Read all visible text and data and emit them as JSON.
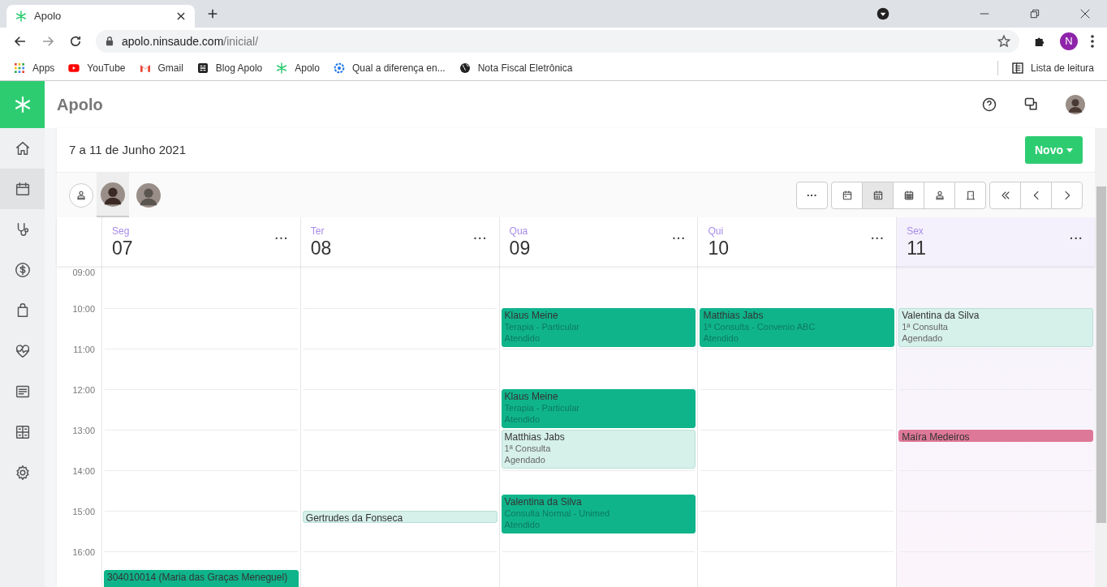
{
  "browser": {
    "tab": {
      "title": "Apolo"
    },
    "address": {
      "host": "apolo.ninsaude.com",
      "path": "/inicial/"
    },
    "profile_initial": "N",
    "bookmarks": [
      {
        "label": "Apps"
      },
      {
        "label": "YouTube"
      },
      {
        "label": "Gmail"
      },
      {
        "label": "Blog Apolo"
      },
      {
        "label": "Apolo"
      },
      {
        "label": "Qual a diferença en..."
      },
      {
        "label": "Nota Fiscal Eletrônica"
      }
    ],
    "reading_list": "Lista de leitura"
  },
  "app": {
    "name": "Apolo"
  },
  "sidebar": {
    "items": [
      {
        "selected": false
      },
      {
        "selected": true
      },
      {
        "selected": false
      },
      {
        "selected": false
      },
      {
        "selected": false
      },
      {
        "selected": false
      },
      {
        "selected": false
      },
      {
        "selected": false
      },
      {
        "selected": false
      }
    ]
  },
  "page": {
    "title": "7 a 11 de Junho 2021",
    "new_button": "Novo"
  },
  "professionals": [
    {
      "selected": true
    },
    {
      "selected": false
    }
  ],
  "toolbar": {
    "more": "···",
    "views": [
      {
        "selected": false
      },
      {
        "selected": true
      },
      {
        "selected": false
      },
      {
        "selected": false
      },
      {
        "selected": false
      }
    ]
  },
  "calendar": {
    "hours": [
      "09:00",
      "10:00",
      "11:00",
      "12:00",
      "13:00",
      "14:00",
      "15:00",
      "16:00"
    ],
    "days": [
      {
        "weekday": "Seg",
        "date": "07",
        "menu": "···",
        "today": false,
        "events": [
          {
            "kind": "attended",
            "lines": [
              "304010014 (Maria das Graças Meneguel)"
            ]
          }
        ]
      },
      {
        "weekday": "Ter",
        "date": "08",
        "menu": "···",
        "today": false,
        "events": [
          {
            "kind": "scheduled",
            "lines": [
              "Gertrudes da Fonseca"
            ]
          }
        ]
      },
      {
        "weekday": "Qua",
        "date": "09",
        "menu": "···",
        "today": false,
        "events": [
          {
            "kind": "attended",
            "lines": [
              "Klaus Meine",
              "Terapia - Particular",
              "Atendido"
            ]
          },
          {
            "kind": "attended",
            "lines": [
              "Klaus Meine",
              "Terapia - Particular",
              "Atendido"
            ]
          },
          {
            "kind": "scheduled",
            "lines": [
              "Matthias Jabs",
              "1ª Consulta",
              "Agendado"
            ]
          },
          {
            "kind": "attended",
            "lines": [
              "Valentina da Silva",
              "Consulta Normal - Unimed",
              "Atendido"
            ]
          }
        ]
      },
      {
        "weekday": "Qui",
        "date": "10",
        "menu": "···",
        "today": false,
        "events": [
          {
            "kind": "attended",
            "lines": [
              "Matthias Jabs",
              "1ª Consulta - Convenio ABC",
              "Atendido"
            ]
          }
        ]
      },
      {
        "weekday": "Sex",
        "date": "11",
        "menu": "···",
        "today": true,
        "events": [
          {
            "kind": "scheduled",
            "lines": [
              "Valentina da Silva",
              "1ª Consulta",
              "Agendado"
            ]
          },
          {
            "kind": "blocked",
            "lines": [
              "Maíra Medeiros"
            ]
          }
        ]
      }
    ]
  }
}
